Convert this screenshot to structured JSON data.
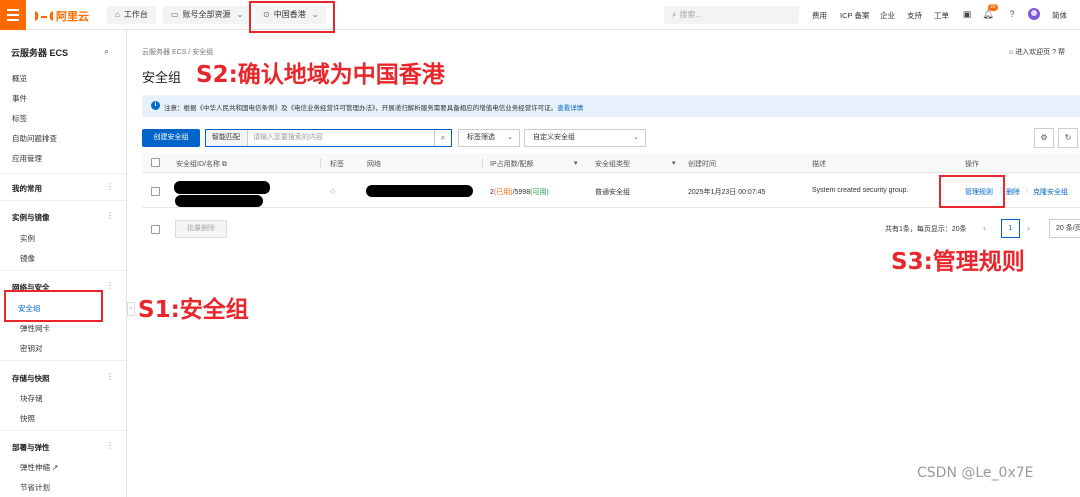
{
  "topbar": {
    "logo_text": "阿里云",
    "workbench": "工作台",
    "account_resources": "账号全部资源",
    "region": "中国香港",
    "search_placeholder": "搜索...",
    "links": [
      "费用",
      "ICP 备案",
      "企业",
      "支持",
      "工单"
    ],
    "notification_count": "20",
    "language": "简体"
  },
  "sidebar": {
    "title": "云服务器 ECS",
    "items": [
      "概览",
      "事件",
      "标签",
      "自助问题排查",
      "应用管理"
    ],
    "favorites": "我的常用",
    "groups": [
      {
        "label": "实例与镜像",
        "items": [
          "实例",
          "镜像"
        ]
      },
      {
        "label": "网络与安全",
        "items": [
          "安全组",
          "弹性网卡",
          "密钥对"
        ]
      },
      {
        "label": "存储与快照",
        "items": [
          "块存储",
          "快照"
        ]
      },
      {
        "label": "部署与弹性",
        "items": [
          "弹性伸缩",
          "节省计划"
        ]
      }
    ]
  },
  "breadcrumb": [
    "云服务器 ECS",
    "安全组"
  ],
  "page_title": "安全组",
  "header_links": [
    "进入欢迎页",
    "帮"
  ],
  "notice": {
    "text": "注意：根据《中华人民共和国电信条例》及《电信业务经营许可管理办法》，开展递归解析服务需要具备相应的增值电信业务经营许可证。",
    "link": "查看详情"
  },
  "toolbar": {
    "create": "创建安全组",
    "filter_mode": "智能匹配",
    "filter_placeholder": "请输入您要搜索的内容",
    "tag_filter": "标签筛选",
    "custom_group": "自定义安全组"
  },
  "table": {
    "headers": [
      "安全组ID/名称",
      "标签",
      "网络",
      "IP占用数/配额",
      "安全组类型",
      "创建时间",
      "描述",
      "操作"
    ],
    "rows": [
      {
        "ip_used": "2",
        "ip_used_label": "(已用)",
        "ip_quota": "/5998",
        "ip_quota_label": "(可用)",
        "type": "普通安全组",
        "created": "2025年1月23日 00:07:45",
        "description": "System created security group.",
        "actions": [
          "管理规则",
          "删除",
          "克隆安全组"
        ]
      }
    ]
  },
  "footer": {
    "bulk_delete": "批量删除",
    "summary": "共有1条，每页显示：20条",
    "current_page": "1",
    "page_size": "20 条/页"
  },
  "annotations": {
    "s1": "S1:安全组",
    "s2": "S2:确认地域为中国香港",
    "s3": "S3:管理规则"
  },
  "watermark": "CSDN @Le_0x7E",
  "colors": {
    "brand": "#ff6a00",
    "primary": "#0064c8",
    "annotation": "#e8262b",
    "available": "#1a9b3c"
  }
}
